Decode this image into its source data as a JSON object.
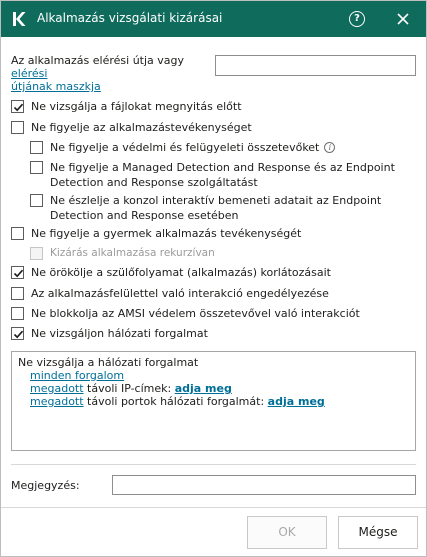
{
  "window": {
    "title": "Alkalmazás vizsgálati kizárásai",
    "help_glyph": "?"
  },
  "path": {
    "label_prefix": "Az alkalmazás elérési útja vagy ",
    "label_link_1": "elérési",
    "label_link_2": "útjának maszkja",
    "value": ""
  },
  "options": {
    "no_scan_files": {
      "label": "Ne vizsgálja a fájlokat megnyitás előtt",
      "checked": true
    },
    "no_monitor_activity": {
      "label": "Ne figyelje az alkalmazástevékenységet",
      "checked": false
    },
    "no_monitor_protection": {
      "label": "Ne figyelje a védelmi és felügyeleti összetevőket",
      "checked": false
    },
    "no_monitor_mdr": {
      "label": "Ne figyelje a Managed Detection and Response és az Endpoint Detection and Response szolgáltatást",
      "checked": false
    },
    "no_detect_console": {
      "label": "Ne észlelje a konzol interaktív bemeneti adatait az Endpoint Detection and Response esetében",
      "checked": false
    },
    "no_monitor_child": {
      "label": "Ne figyelje a gyermek alkalmazás tevékenységét",
      "checked": false
    },
    "recursive_exclusion": {
      "label": "Kizárás alkalmazása rekurzívan",
      "checked": false,
      "disabled": true
    },
    "no_inherit": {
      "label": "Ne örökölje a szülőfolyamat (alkalmazás) korlátozásait",
      "checked": true
    },
    "allow_ui_interaction": {
      "label": "Az alkalmazásfelülettel való interakció engedélyezése",
      "checked": false
    },
    "no_block_amsi": {
      "label": "Ne blokkolja az AMSI védelem összetevővel való interakciót",
      "checked": false
    },
    "no_scan_network": {
      "label": "Ne vizsgáljon hálózati forgalmat",
      "checked": true
    }
  },
  "network": {
    "title": "Ne vizsgálja a hálózati forgalmat",
    "all_traffic": "minden forgalom",
    "specified_1": "megadott",
    "remote_ip_text": " távoli IP-címek: ",
    "specify_1": "adja meg",
    "specified_2": "megadott",
    "remote_ports_text": " távoli portok hálózati forgalmát: ",
    "specify_2": "adja meg"
  },
  "comment": {
    "label": "Megjegyzés:",
    "value": ""
  },
  "buttons": {
    "ok": "OK",
    "cancel": "Mégse"
  },
  "colors": {
    "titlebar": "#0f6b5c",
    "link": "#006f98"
  },
  "icons": {
    "app": "kaspersky-k-icon",
    "help": "help-circle-icon",
    "close": "close-icon",
    "check": "checkmark-icon",
    "info": "info-icon"
  }
}
